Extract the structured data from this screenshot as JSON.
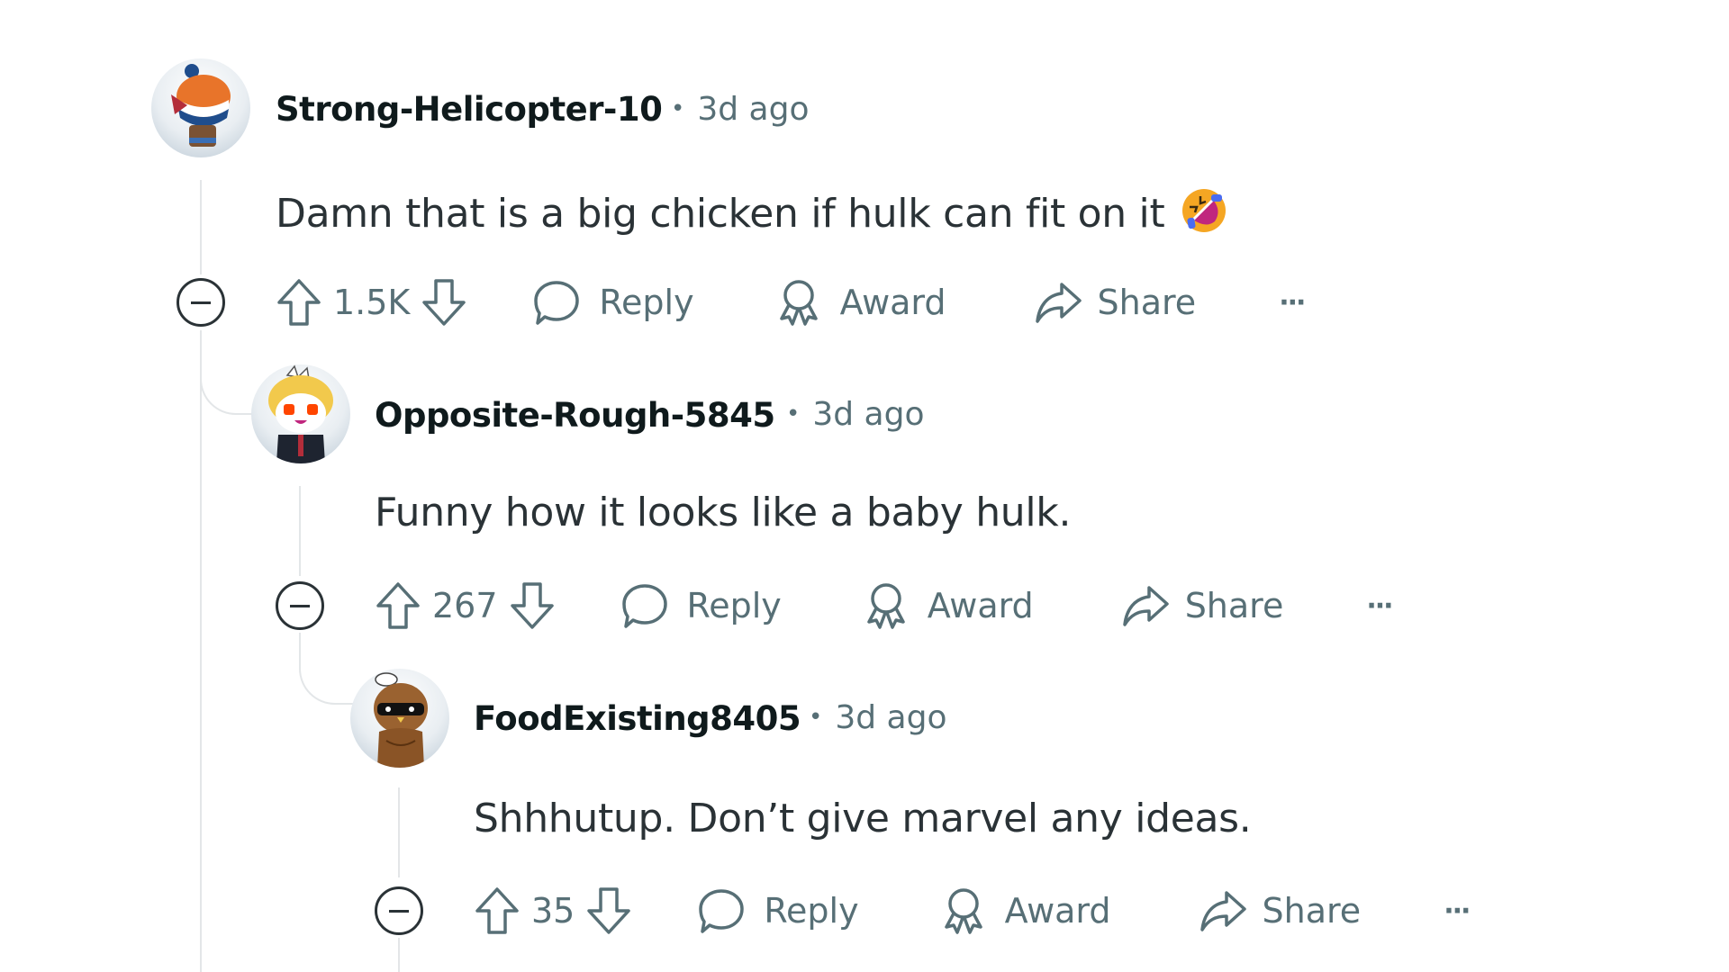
{
  "comments": [
    {
      "author": "Strong-Helicopter-10",
      "separator": "•",
      "time": "3d ago",
      "body": "Damn that is a big chicken if hulk can fit on it",
      "emoji": "rolling-on-floor-laughing",
      "score": "1.5K",
      "actions": {
        "reply": "Reply",
        "award": "Award",
        "share": "Share",
        "more": "···"
      }
    },
    {
      "author": "Opposite-Rough-5845",
      "separator": "•",
      "time": "3d ago",
      "body": "Funny how it looks like a baby hulk.",
      "score": "267",
      "actions": {
        "reply": "Reply",
        "award": "Award",
        "share": "Share",
        "more": "···"
      }
    },
    {
      "author": "FoodExisting8405",
      "separator": "•",
      "time": "3d ago",
      "body": "Shhhutup. Don’t give marvel any ideas.",
      "score": "35",
      "actions": {
        "reply": "Reply",
        "award": "Award",
        "share": "Share",
        "more": "···"
      }
    }
  ],
  "colors": {
    "text": "#2a3236",
    "username": "#0f1a1c",
    "muted": "#576f76",
    "thread_line": "#e3e6e8",
    "background": "#ffffff"
  }
}
